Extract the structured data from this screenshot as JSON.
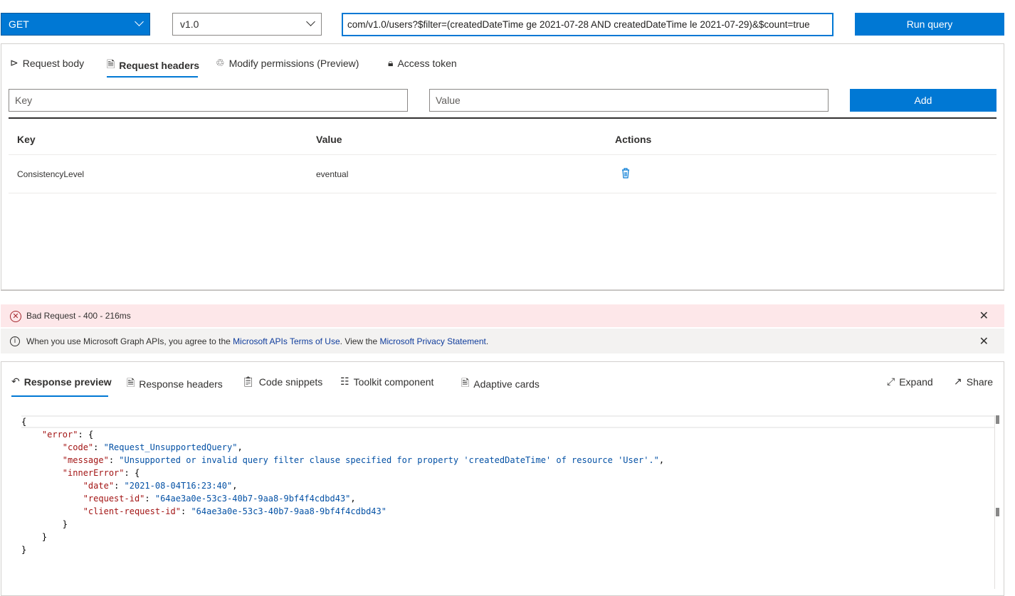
{
  "toolbar": {
    "method": "GET",
    "version": "v1.0",
    "url": "com/v1.0/users?$filter=(createdDateTime ge 2021-07-28 AND createdDateTime le 2021-07-29)&$count=true",
    "run_label": "Run query"
  },
  "request_tabs": [
    {
      "label": "Request body",
      "icon": "send-icon"
    },
    {
      "label": "Request headers",
      "icon": "document-icon",
      "active": true
    },
    {
      "label": "Modify permissions (Preview)",
      "icon": "permissions-icon"
    },
    {
      "label": "Access token",
      "icon": "lock-icon"
    }
  ],
  "headers_form": {
    "key_placeholder": "Key",
    "value_placeholder": "Value",
    "add_label": "Add"
  },
  "headers_table": {
    "columns": [
      "Key",
      "Value",
      "Actions"
    ],
    "rows": [
      {
        "key": "ConsistencyLevel",
        "value": "eventual",
        "action_icon": "delete-icon"
      }
    ]
  },
  "status": {
    "text": "Bad Request - 400 - 216ms",
    "color": "#fde7e9",
    "icon": "error-circle-icon"
  },
  "notice": {
    "prefix": "When you use Microsoft Graph APIs, you agree to the ",
    "terms_link": "Microsoft APIs Terms of Use",
    "middle": ". View the ",
    "privacy_link": "Microsoft Privacy Statement",
    "suffix": "."
  },
  "response_tabs": [
    {
      "label": "Response preview",
      "icon": "undo-icon",
      "active": true
    },
    {
      "label": "Response headers",
      "icon": "document-icon"
    },
    {
      "label": "Code snippets",
      "icon": "code-icon"
    },
    {
      "label": "Toolkit component",
      "icon": "toolkit-icon"
    },
    {
      "label": "Adaptive cards",
      "icon": "card-icon"
    }
  ],
  "response_actions": [
    {
      "label": "Expand",
      "icon": "expand-icon"
    },
    {
      "label": "Share",
      "icon": "share-icon"
    }
  ],
  "response_lines": [
    {
      "indent": 0,
      "text": "{"
    },
    {
      "indent": 1,
      "key": "error",
      "text": "{"
    },
    {
      "indent": 2,
      "key": "code",
      "value": "Request_UnsupportedQuery",
      "text": ","
    },
    {
      "indent": 2,
      "key": "message",
      "value": "Unsupported or invalid query filter clause specified for property 'createdDateTime' of resource 'User'.",
      "text": ","
    },
    {
      "indent": 2,
      "key": "innerError",
      "text": "{"
    },
    {
      "indent": 3,
      "key": "date",
      "value": "2021-08-04T16:23:40",
      "text": ","
    },
    {
      "indent": 3,
      "key": "request-id",
      "value": "64ae3a0e-53c3-40b7-9aa8-9bf4f4cdbd43",
      "text": ","
    },
    {
      "indent": 3,
      "key": "client-request-id",
      "value": "64ae3a0e-53c3-40b7-9aa8-9bf4f4cdbd43",
      "text": ""
    },
    {
      "indent": 2,
      "text": "}"
    },
    {
      "indent": 1,
      "text": "}"
    },
    {
      "indent": 0,
      "text": "}"
    }
  ]
}
